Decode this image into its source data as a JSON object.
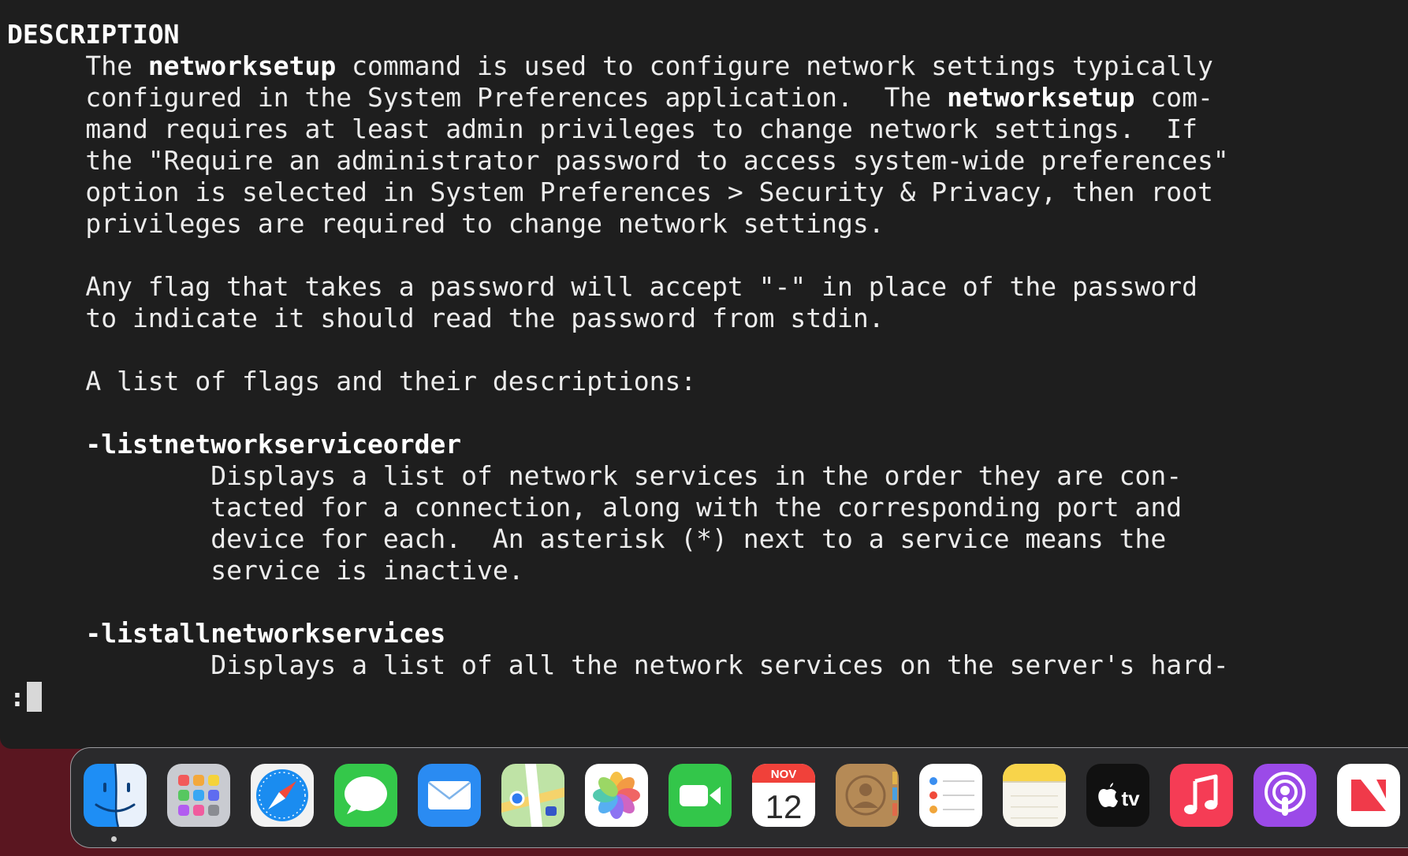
{
  "terminal": {
    "lines": [
      [
        {
          "t": "DESCRIPTION",
          "b": true
        }
      ],
      [
        {
          "t": "     The "
        },
        {
          "t": "networksetup",
          "b": true
        },
        {
          "t": " command is used to configure network settings typically"
        }
      ],
      [
        {
          "t": "     configured in the System Preferences application.  The "
        },
        {
          "t": "networksetup",
          "b": true
        },
        {
          "t": " com-"
        }
      ],
      [
        {
          "t": "     mand requires at least admin privileges to change network settings.  If"
        }
      ],
      [
        {
          "t": "     the \"Require an administrator password to access system-wide preferences\""
        }
      ],
      [
        {
          "t": "     option is selected in System Preferences > Security & Privacy, then root"
        }
      ],
      [
        {
          "t": "     privileges are required to change network settings."
        }
      ],
      [
        {
          "t": ""
        }
      ],
      [
        {
          "t": "     Any flag that takes a password will accept \"-\" in place of the password"
        }
      ],
      [
        {
          "t": "     to indicate it should read the password from stdin."
        }
      ],
      [
        {
          "t": ""
        }
      ],
      [
        {
          "t": "     A list of flags and their descriptions:"
        }
      ],
      [
        {
          "t": ""
        }
      ],
      [
        {
          "t": "     "
        },
        {
          "t": "-listnetworkserviceorder",
          "b": true
        }
      ],
      [
        {
          "t": "             Displays a list of network services in the order they are con-"
        }
      ],
      [
        {
          "t": "             tacted for a connection, along with the corresponding port and"
        }
      ],
      [
        {
          "t": "             device for each.  An asterisk (*) next to a service means the"
        }
      ],
      [
        {
          "t": "             service is inactive."
        }
      ],
      [
        {
          "t": ""
        }
      ],
      [
        {
          "t": "     "
        },
        {
          "t": "-listallnetworkservices",
          "b": true
        }
      ],
      [
        {
          "t": "             Displays a list of all the network services on the server's hard-"
        }
      ]
    ],
    "prompt": ":"
  },
  "dock": {
    "apps": [
      {
        "name": "finder",
        "icon": "finder-icon",
        "running": true
      },
      {
        "name": "launchpad",
        "icon": "launchpad-icon"
      },
      {
        "name": "safari",
        "icon": "safari-icon"
      },
      {
        "name": "messages",
        "icon": "messages-icon"
      },
      {
        "name": "mail",
        "icon": "mail-icon"
      },
      {
        "name": "maps",
        "icon": "maps-icon"
      },
      {
        "name": "photos",
        "icon": "photos-icon"
      },
      {
        "name": "facetime",
        "icon": "facetime-icon"
      },
      {
        "name": "calendar",
        "icon": "calendar-icon",
        "month": "NOV",
        "day": "12"
      },
      {
        "name": "contacts",
        "icon": "contacts-icon"
      },
      {
        "name": "reminders",
        "icon": "reminders-icon"
      },
      {
        "name": "notes",
        "icon": "notes-icon"
      },
      {
        "name": "apple-tv",
        "icon": "apple-tv-icon",
        "label": "tv"
      },
      {
        "name": "music",
        "icon": "music-icon"
      },
      {
        "name": "podcasts",
        "icon": "podcasts-icon"
      },
      {
        "name": "news",
        "icon": "news-icon"
      }
    ]
  },
  "colors": {
    "terminal_bg": "#1e1e1e",
    "desktop_bg": "#5a1620",
    "text": "#ececec"
  }
}
